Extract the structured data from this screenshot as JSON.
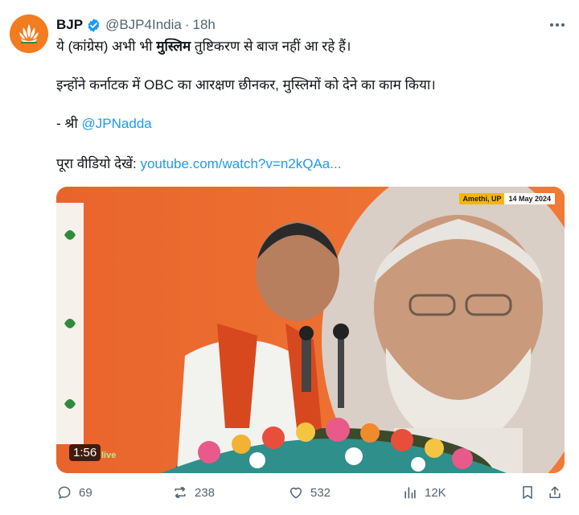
{
  "author": {
    "name": "BJP",
    "handle": "@BJP4India",
    "separator": "·",
    "time": "18h"
  },
  "tweet": {
    "line1_a": "ये (कांग्रेस) अभी भी ",
    "line1_bold": "मुस्लिम",
    "line1_b": " तुष्टिकरण से बाज नहीं आ रहे हैं।",
    "line2": "इन्होंने कर्नाटक में OBC का आरक्षण छीनकर, मुस्लिमों को देने का काम किया।",
    "line3_prefix": "- श्री ",
    "line3_mention": "@JPNadda",
    "line4_prefix": "पूरा वीडियो देखें: ",
    "line4_link": "youtube.com/watch?v=n2kQAa..."
  },
  "video": {
    "location_badge": "Amethi, UP",
    "date_badge": "14 May 2024",
    "duration": "1:56",
    "watermark": "live"
  },
  "actions": {
    "replies": "69",
    "reposts": "238",
    "likes": "532",
    "views": "12K"
  },
  "colors": {
    "link": "#1d9bf0",
    "muted": "#536471",
    "saffron": "#f47c20",
    "verified": "#1d9bf0"
  }
}
